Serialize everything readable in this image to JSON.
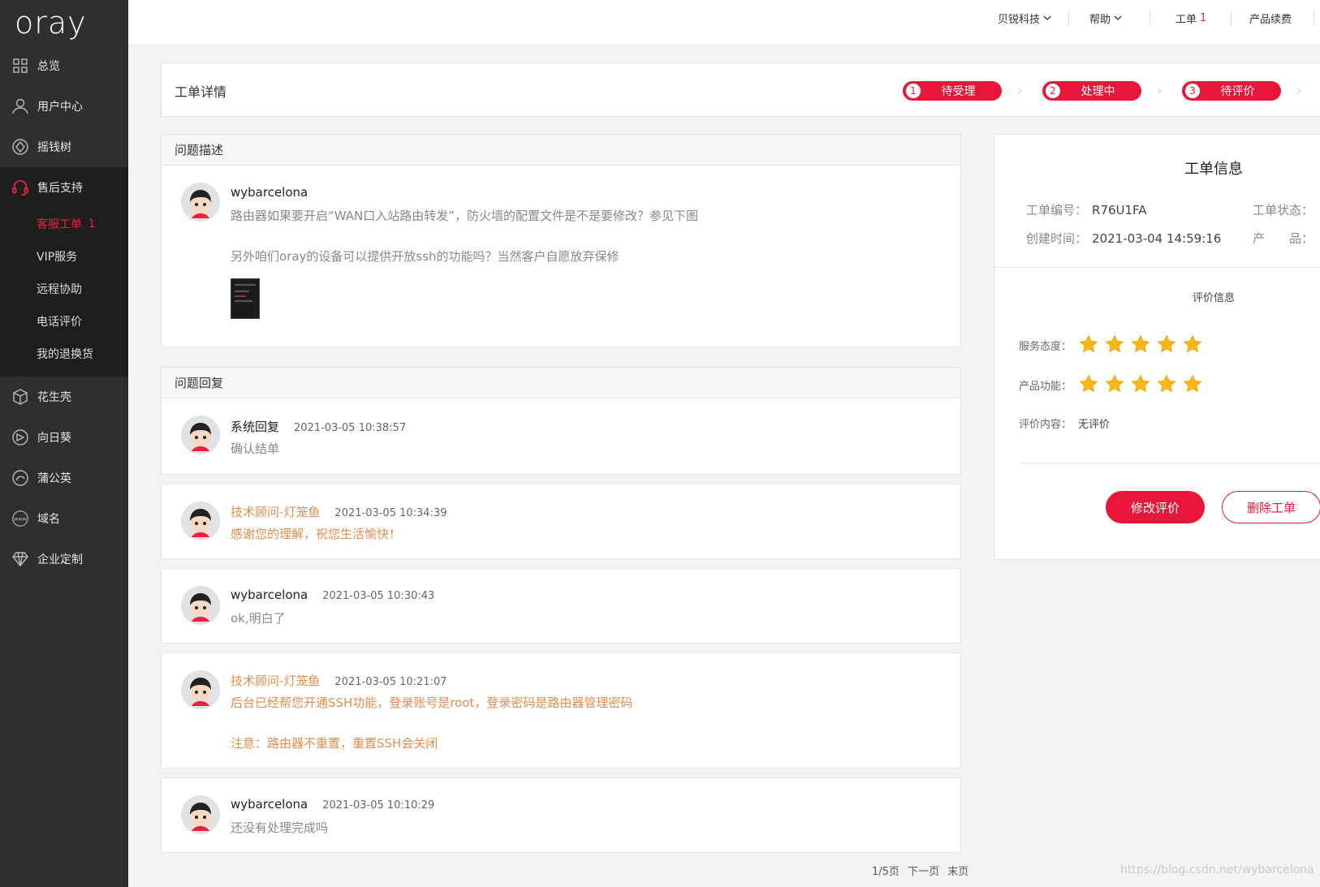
{
  "app": {
    "logo": "oray"
  },
  "sidebar": {
    "items": [
      {
        "label": "总览",
        "icon": "grid-icon"
      },
      {
        "label": "用户中心",
        "icon": "user-icon"
      },
      {
        "label": "摇钱树",
        "icon": "tree-icon"
      },
      {
        "label": "售后支持",
        "icon": "headset-icon"
      }
    ],
    "support_sub": [
      {
        "label": "客服工单",
        "count": "1"
      },
      {
        "label": "VIP服务"
      },
      {
        "label": "远程协助"
      },
      {
        "label": "电话评价"
      },
      {
        "label": "我的退换货"
      }
    ],
    "products": [
      {
        "label": "花生壳",
        "icon": "box-icon"
      },
      {
        "label": "向日葵",
        "icon": "sunflower-icon"
      },
      {
        "label": "蒲公英",
        "icon": "dandelion-icon"
      },
      {
        "label": "域名",
        "icon": "www-icon"
      },
      {
        "label": "企业定制",
        "icon": "diamond-icon"
      }
    ]
  },
  "topbar": {
    "company": "贝锐科技",
    "help": "帮助",
    "ticket": "工单",
    "ticket_count": "1",
    "renew": "产品续费"
  },
  "header": {
    "title": "工单详情",
    "steps": [
      {
        "num": "1",
        "label": "待受理"
      },
      {
        "num": "2",
        "label": "处理中"
      },
      {
        "num": "3",
        "label": "待评价"
      }
    ]
  },
  "question": {
    "section_title": "问题描述",
    "author": "wybarcelona",
    "line1": "路由器如果要开启“WAN口入站路由转发”，防火墙的配置文件是不是要修改？参见下图",
    "line2": "另外咱们oray的设备可以提供开放ssh的功能吗？当然客户自愿放弃保修"
  },
  "replies": {
    "section_title": "问题回复",
    "items": [
      {
        "author": "系统回复",
        "time": "2021-03-05 10:38:57",
        "text": "确认结单",
        "staff": false
      },
      {
        "author": "技术顾问-灯笼鱼",
        "time": "2021-03-05 10:34:39",
        "text": "感谢您的理解，祝您生活愉快！",
        "staff": true
      },
      {
        "author": "wybarcelona",
        "time": "2021-03-05 10:30:43",
        "text": "ok,明白了",
        "staff": false
      },
      {
        "author": "技术顾问-灯笼鱼",
        "time": "2021-03-05 10:21:07",
        "text": "后台已经帮您开通SSH功能，登录账号是root，登录密码是路由器管理密码",
        "text2": "注意：路由器不重置，重置SSH会关闭",
        "staff": true
      },
      {
        "author": "wybarcelona",
        "time": "2021-03-05 10:10:29",
        "text": "还没有处理完成吗",
        "staff": false
      }
    ]
  },
  "info": {
    "title": "工单信息",
    "id_label": "工单编号：",
    "id_value": "R76U1FA",
    "status_label": "工单状态：",
    "created_label": "创建时间：",
    "created_value": "2021-03-04 14:59:16",
    "product_label": "产　　品：",
    "eval_title": "评价信息",
    "service_label": "服务态度：",
    "service_rating": 5,
    "product_func_label": "产品功能：",
    "product_rating": 5,
    "content_label": "评价内容：",
    "content_value": "无评价",
    "edit_btn": "修改评价",
    "delete_btn": "删除工单"
  },
  "pager": {
    "page": "1/5页",
    "next": "下一页",
    "last": "末页"
  },
  "watermark": "https://blog.csdn.net/wybarcelona",
  "colors": {
    "accent": "#e8173a",
    "staff": "#e08d4f",
    "sidebar": "#2f2f2f"
  }
}
